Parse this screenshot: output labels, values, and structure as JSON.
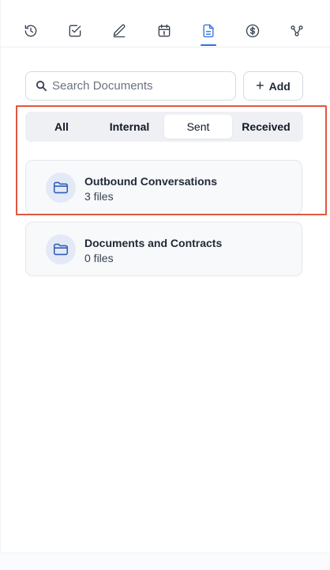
{
  "nav": {
    "items": [
      {
        "name": "history",
        "icon": "clock-history-icon"
      },
      {
        "name": "tasks",
        "icon": "checkbox-icon"
      },
      {
        "name": "notes",
        "icon": "pen-icon"
      },
      {
        "name": "calendar",
        "icon": "calendar-icon"
      },
      {
        "name": "documents",
        "icon": "document-icon",
        "active": true
      },
      {
        "name": "billing",
        "icon": "dollar-circle-icon"
      },
      {
        "name": "workflow",
        "icon": "share-nodes-icon"
      }
    ],
    "active_color": "#2f6fe0"
  },
  "search": {
    "placeholder": "Search Documents"
  },
  "add_button": {
    "label": "Add"
  },
  "tabs": [
    {
      "label": "All",
      "active": false
    },
    {
      "label": "Internal",
      "active": false
    },
    {
      "label": "Sent",
      "active": true
    },
    {
      "label": "Received",
      "active": false
    }
  ],
  "folders": [
    {
      "title": "Outbound Conversations",
      "count": "3 files"
    },
    {
      "title": "Documents and Contracts",
      "count": "0 files"
    }
  ],
  "highlight_color": "#e0573f"
}
